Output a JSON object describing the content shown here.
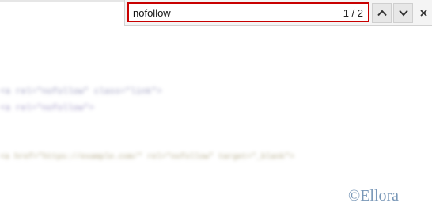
{
  "find_bar": {
    "query": "nofollow",
    "match_count": "1 / 2",
    "prev_icon": "chevron-up-icon",
    "next_icon": "chevron-down-icon",
    "close_icon": "close-icon",
    "accent_color": "#c80000"
  },
  "page": {
    "blurred_lines": [
      "<a rel=\"nofollow\" class=\"link\">",
      "<a rel=\"nofollow\">",
      "<a href=\"https://example.com/\" rel=\"nofollow\" target=\"_blank\">"
    ]
  },
  "watermark": "©Ellora"
}
